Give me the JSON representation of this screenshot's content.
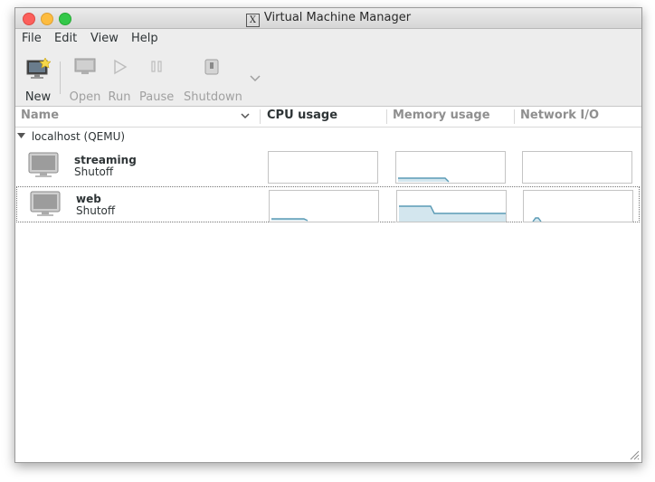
{
  "window": {
    "title": "Virtual Machine Manager"
  },
  "menu": [
    "File",
    "Edit",
    "View",
    "Help"
  ],
  "toolbar": {
    "new": "New",
    "open": "Open",
    "run": "Run",
    "pause": "Pause",
    "shutdown": "Shutdown"
  },
  "columns": {
    "name": "Name",
    "cpu": "CPU usage",
    "memory": "Memory usage",
    "network": "Network I/O"
  },
  "connection": {
    "label": "localhost (QEMU)"
  },
  "vms": [
    {
      "name": "streaming",
      "state": "Shutoff",
      "selected": false
    },
    {
      "name": "web",
      "state": "Shutoff",
      "selected": true
    }
  ],
  "colors": {
    "graph_line": "#5b9bb5",
    "graph_fill": "#d3e6ee"
  }
}
